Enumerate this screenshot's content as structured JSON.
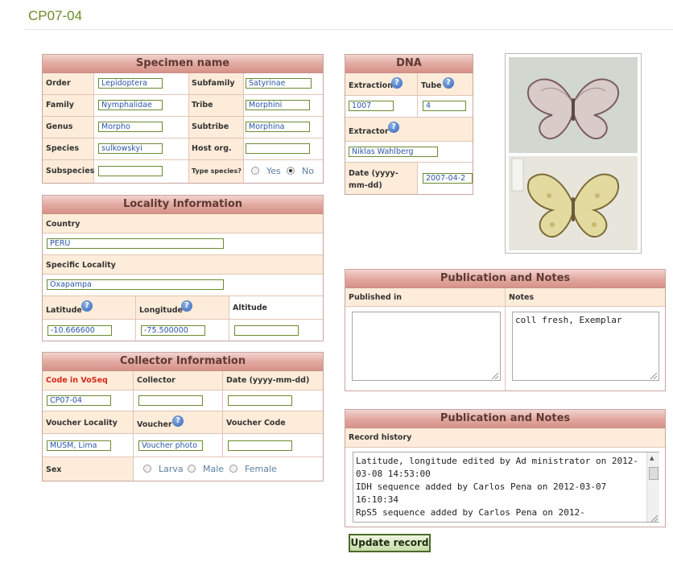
{
  "page": {
    "title": "CP07-04"
  },
  "specimen": {
    "heading": "Specimen name",
    "order_label": "Order",
    "order": "Lepidoptera",
    "subfamily_label": "Subfamily",
    "subfamily": "Satyrinae",
    "family_label": "Family",
    "family": "Nymphalidae",
    "tribe_label": "Tribe",
    "tribe": "Morphini",
    "genus_label": "Genus",
    "genus": "Morpho",
    "subtribe_label": "Subtribe",
    "subtribe": "Morphina",
    "species_label": "Species",
    "species": "sulkowskyi",
    "hostorg_label": "Host org.",
    "hostorg": "",
    "subspecies_label": "Subspecies",
    "subspecies": "",
    "typespecies_label": "Type species?",
    "yes_label": "Yes",
    "no_label": "No",
    "type_species_selected": "No"
  },
  "dna": {
    "heading": "DNA",
    "extraction_label": "Extraction",
    "extraction": "1007",
    "tube_label": "Tube",
    "tube": "4",
    "extractor_label": "Extractor",
    "extractor": "Niklas Wahlberg",
    "date_label": "Date (yyyy-mm-dd)",
    "date": "2007-04-2"
  },
  "locality": {
    "heading": "Locality Information",
    "country_label": "Country",
    "country": "PERU",
    "specific_label": "Specific Locality",
    "specific": "Oxapampa",
    "latitude_label": "Latitude",
    "latitude": "-10.666600",
    "longitude_label": "Longitude",
    "longitude": "-75.500000",
    "altitude_label": "Altitude",
    "altitude": ""
  },
  "collector": {
    "heading": "Collector Information",
    "code_label": "Code in VoSeq",
    "code": "CP07-04",
    "collector_label": "Collector",
    "collector": "",
    "date_label": "Date (yyyy-mm-dd)",
    "date": "",
    "voucher_locality_label": "Voucher Locality",
    "voucher_locality": "MUSM, Lima",
    "voucher_label": "Voucher",
    "voucher": "Voucher photo",
    "voucher_code_label": "Voucher Code",
    "voucher_code": "",
    "sex_label": "Sex",
    "larva_label": "Larva",
    "male_label": "Male",
    "female_label": "Female"
  },
  "publication": {
    "heading": "Publication and Notes",
    "published_label": "Published in",
    "published": "",
    "notes_label": "Notes",
    "notes": "coll fresh, Exemplar"
  },
  "history": {
    "heading": "Publication and Notes",
    "label": "Record history",
    "text": "Latitude, longitude edited by Ad ministrator on 2012-03-08 14:53:00\nIDH sequence added by Carlos Pena on 2012-03-07 16:10:34\nRpS5 sequence added by Carlos Pena on 2012-"
  },
  "actions": {
    "update_label": "Update record"
  },
  "icons": {
    "help": "help-icon",
    "photo": "butterfly-photo"
  },
  "colors": {
    "accent_title": "#6f8a2a",
    "header_band": "#e2aaa2",
    "label_bg": "#fdecd9",
    "required_label": "#d6281b"
  }
}
